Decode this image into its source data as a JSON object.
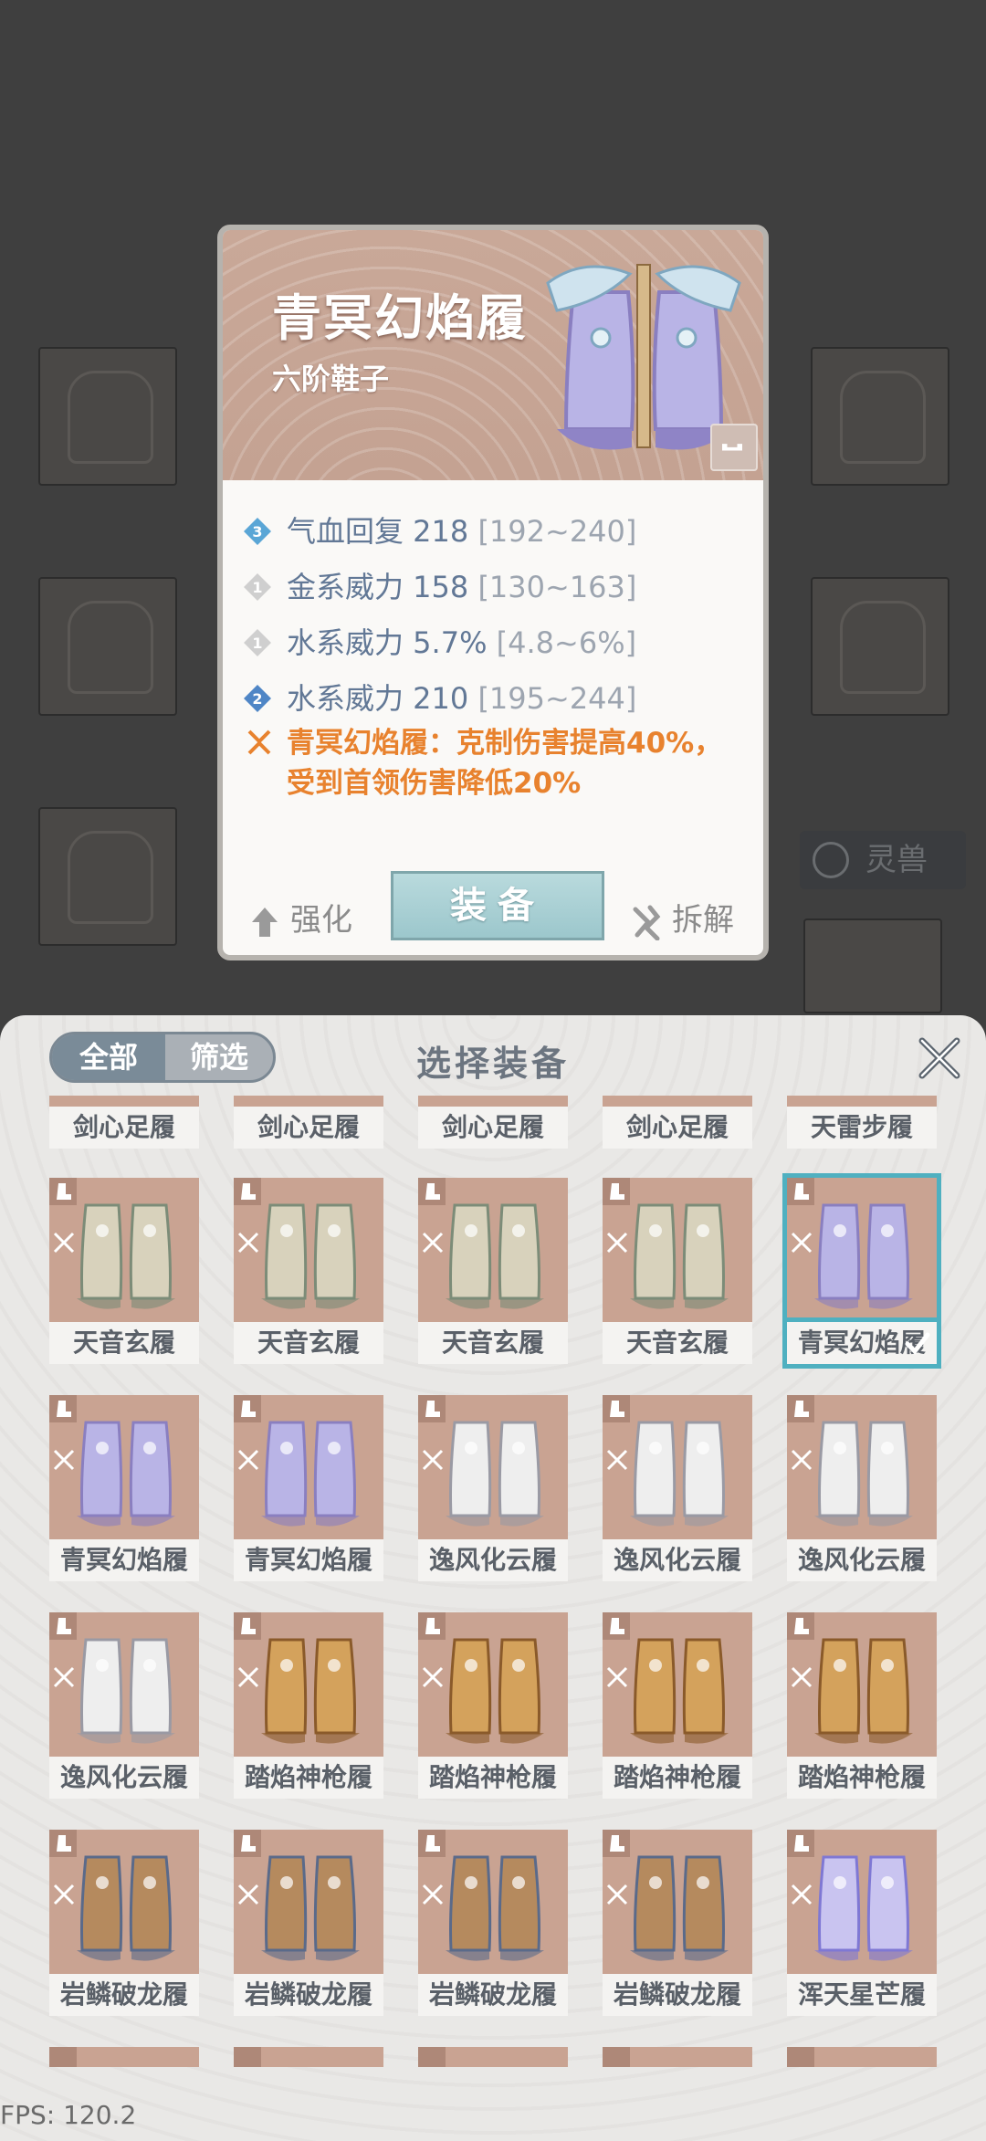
{
  "background": {
    "pet_label": "灵兽"
  },
  "detail": {
    "name": "青冥幻焰履",
    "type": "六阶鞋子",
    "stats": [
      {
        "level": "3",
        "name": "气血回复 218",
        "range": "[192~240]"
      },
      {
        "level": "1",
        "name": "金系威力 158",
        "range": "[130~163]"
      },
      {
        "level": "1",
        "name": "水系威力 5.7%",
        "range": "[4.8~6%]"
      },
      {
        "level": "2",
        "name": "水系威力 210",
        "range": "[195~244]"
      }
    ],
    "effect_line1": "青冥幻焰履：克制伤害提高40%，",
    "effect_line2": "受到首领伤害降低20%",
    "upgrade_label": "强化",
    "equip_label": "装备",
    "dismantle_label": "拆解"
  },
  "panel": {
    "tab_all": "全部",
    "tab_filter": "筛选",
    "title": "选择装备",
    "items": [
      "剑心足履",
      "剑心足履",
      "剑心足履",
      "剑心足履",
      "天雷步履",
      "天音玄履",
      "天音玄履",
      "天音玄履",
      "天音玄履",
      "青冥幻焰履",
      "青冥幻焰履",
      "青冥幻焰履",
      "逸风化云履",
      "逸风化云履",
      "逸风化云履",
      "逸风化云履",
      "踏焰神枪履",
      "踏焰神枪履",
      "踏焰神枪履",
      "踏焰神枪履",
      "岩鳞破龙履",
      "岩鳞破龙履",
      "岩鳞破龙履",
      "岩鳞破龙履",
      "浑天星芒履"
    ],
    "selected_index": 9
  },
  "colors": {
    "accent": "#4fb0c0",
    "effect": "#e8822e",
    "stat_text": "#627896"
  },
  "fps": "FPS: 120.2"
}
